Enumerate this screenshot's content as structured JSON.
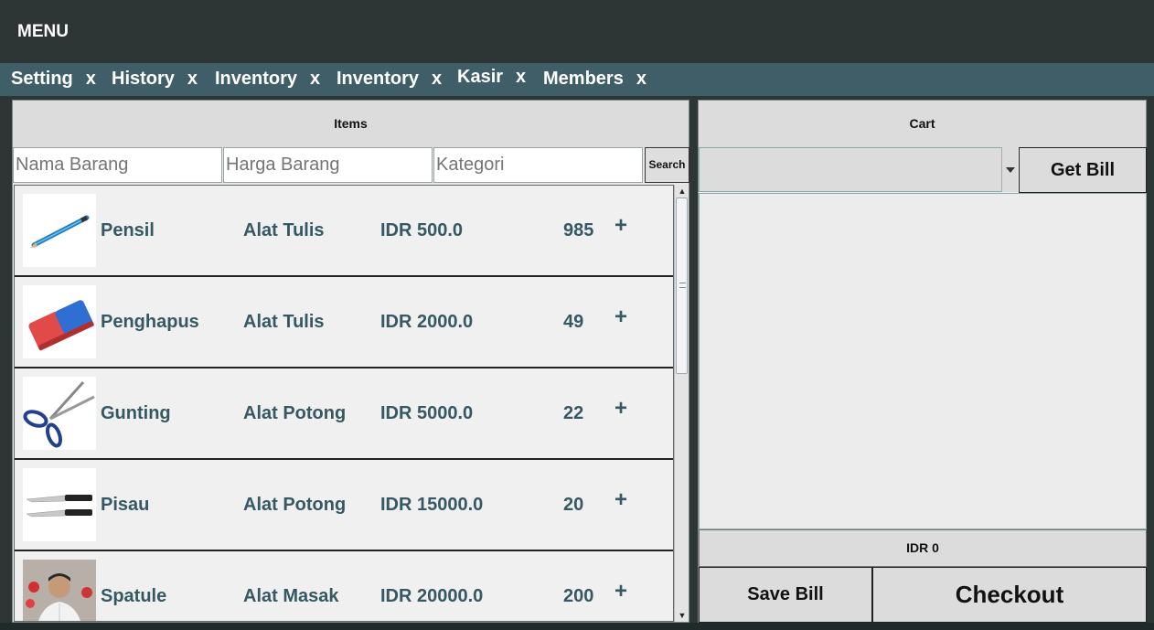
{
  "app": {
    "menu_label": "MENU"
  },
  "tabs": [
    {
      "label": "Setting",
      "close": "x"
    },
    {
      "label": "History",
      "close": "x"
    },
    {
      "label": "Inventory",
      "close": "x"
    },
    {
      "label": "Inventory",
      "close": "x"
    },
    {
      "label": "Kasir",
      "close": "x"
    },
    {
      "label": "Members",
      "close": "x"
    }
  ],
  "items": {
    "title": "Items",
    "search": {
      "name_placeholder": "Nama Barang",
      "price_placeholder": "Harga Barang",
      "category_placeholder": "Kategori",
      "button_label": "Search"
    },
    "rows": [
      {
        "name": "Pensil",
        "category": "Alat Tulis",
        "price": "IDR 500.0",
        "stock": "985",
        "add": "+",
        "icon": "pencil-image"
      },
      {
        "name": "Penghapus",
        "category": "Alat Tulis",
        "price": "IDR 2000.0",
        "stock": "49",
        "add": "+",
        "icon": "eraser-image"
      },
      {
        "name": "Gunting",
        "category": "Alat Potong",
        "price": "IDR 5000.0",
        "stock": "22",
        "add": "+",
        "icon": "scissors-image"
      },
      {
        "name": "Pisau",
        "category": "Alat Potong",
        "price": "IDR 15000.0",
        "stock": "20",
        "add": "+",
        "icon": "knife-image"
      },
      {
        "name": "Spatule",
        "category": "Alat Masak",
        "price": "IDR 20000.0",
        "stock": "200",
        "add": "+",
        "icon": "person-photo-image"
      }
    ]
  },
  "cart": {
    "title": "Cart",
    "select_value": "",
    "get_bill_label": "Get Bill",
    "total": "IDR 0",
    "save_bill_label": "Save Bill",
    "checkout_label": "Checkout"
  },
  "colors": {
    "topbar": "#2e3535",
    "tabbar": "#3f5e68",
    "item_text": "#355862",
    "panel_bg": "#e8e8e8"
  }
}
